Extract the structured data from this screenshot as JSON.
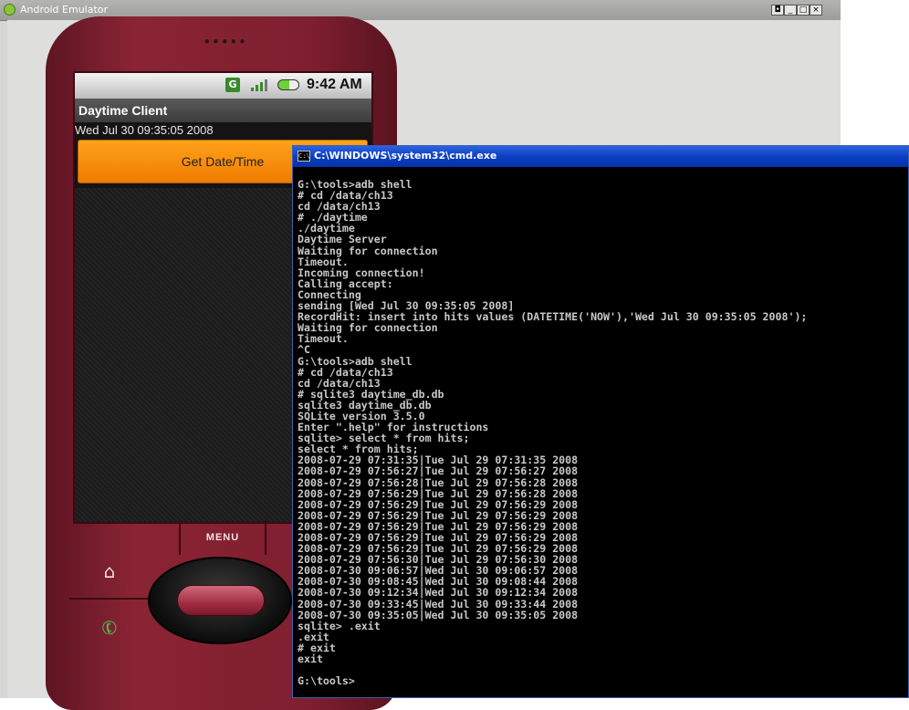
{
  "emulator_window": {
    "title": "Android Emulator",
    "buttons": [
      "◘",
      "_",
      "□",
      "×"
    ]
  },
  "phone": {
    "speaker": "•••••",
    "status_bar": {
      "network_icon": "G",
      "time": "9:42 AM"
    },
    "app": {
      "title": "Daytime Client",
      "date_text": "Wed Jul 30 09:35:05 2008",
      "button_label": "Get Date/Time"
    },
    "keys": {
      "menu_label": "MENU"
    }
  },
  "console_window": {
    "title": "C:\\WINDOWS\\system32\\cmd.exe",
    "lines": [
      "G:\\tools>adb shell",
      "# cd /data/ch13",
      "cd /data/ch13",
      "# ./daytime",
      "./daytime",
      "Daytime Server",
      "Waiting for connection",
      "Timeout.",
      "Incoming connection!",
      "Calling accept:",
      "Connecting",
      "sending [Wed Jul 30 09:35:05 2008]",
      "RecordHit: insert into hits values (DATETIME('NOW'),'Wed Jul 30 09:35:05 2008');",
      "Waiting for connection",
      "Timeout.",
      "^C",
      "G:\\tools>adb shell",
      "# cd /data/ch13",
      "cd /data/ch13",
      "# sqlite3 daytime_db.db",
      "sqlite3 daytime_db.db",
      "SQLite version 3.5.0",
      "Enter \".help\" for instructions",
      "sqlite> select * from hits;",
      "select * from hits;",
      "2008-07-29 07:31:35|Tue Jul 29 07:31:35 2008",
      "2008-07-29 07:56:27|Tue Jul 29 07:56:27 2008",
      "2008-07-29 07:56:28|Tue Jul 29 07:56:28 2008",
      "2008-07-29 07:56:29|Tue Jul 29 07:56:28 2008",
      "2008-07-29 07:56:29|Tue Jul 29 07:56:29 2008",
      "2008-07-29 07:56:29|Tue Jul 29 07:56:29 2008",
      "2008-07-29 07:56:29|Tue Jul 29 07:56:29 2008",
      "2008-07-29 07:56:29|Tue Jul 29 07:56:29 2008",
      "2008-07-29 07:56:29|Tue Jul 29 07:56:29 2008",
      "2008-07-29 07:56:30|Tue Jul 29 07:56:30 2008",
      "2008-07-30 09:06:57|Wed Jul 30 09:06:57 2008",
      "2008-07-30 09:08:45|Wed Jul 30 09:08:44 2008",
      "2008-07-30 09:12:34|Wed Jul 30 09:12:34 2008",
      "2008-07-30 09:33:45|Wed Jul 30 09:33:44 2008",
      "2008-07-30 09:35:05|Wed Jul 30 09:35:05 2008",
      "sqlite> .exit",
      ".exit",
      "# exit",
      "exit",
      "",
      "G:\\tools>"
    ]
  }
}
